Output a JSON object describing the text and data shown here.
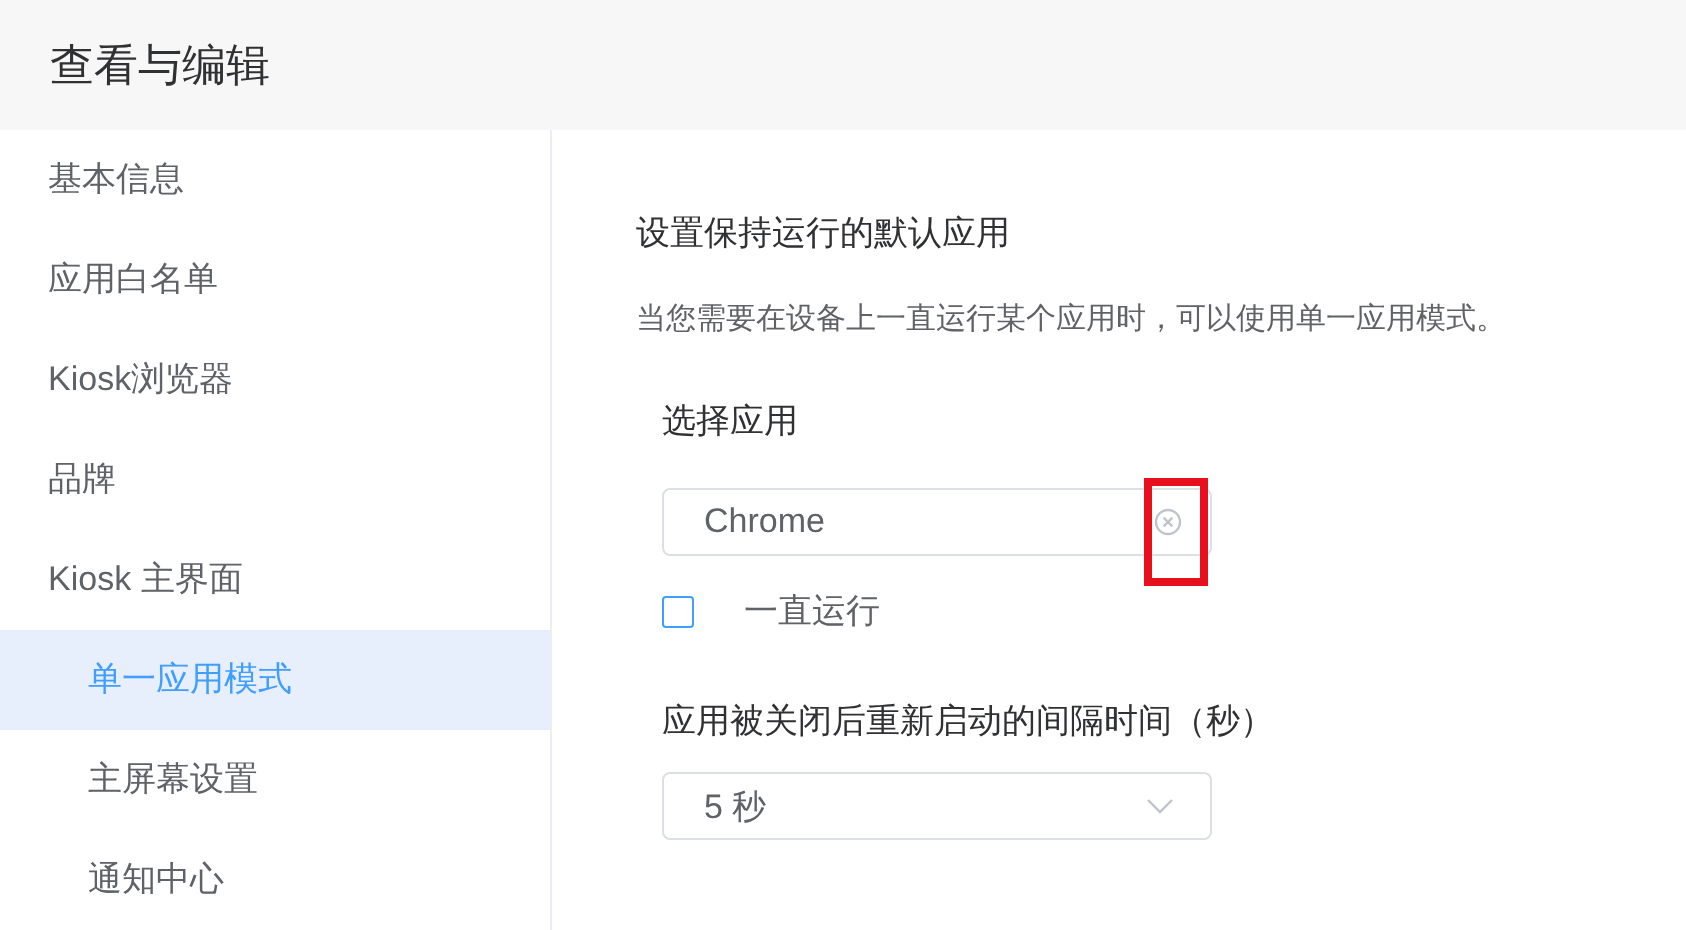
{
  "header": {
    "title": "查看与编辑"
  },
  "sidebar": {
    "items": [
      {
        "label": "基本信息",
        "selected": false
      },
      {
        "label": "应用白名单",
        "selected": false
      },
      {
        "label": "Kiosk浏览器",
        "selected": false
      },
      {
        "label": "品牌",
        "selected": false
      },
      {
        "label": "Kiosk 主界面",
        "selected": false,
        "children": [
          {
            "label": "单一应用模式",
            "selected": true
          },
          {
            "label": "主屏幕设置",
            "selected": false
          },
          {
            "label": "通知中心",
            "selected": false
          }
        ]
      }
    ]
  },
  "content": {
    "heading": "设置保持运行的默认应用",
    "description": "当您需要在设备上一直运行某个应用时，可以使用单一应用模式。",
    "app_field": {
      "label": "选择应用",
      "value": "Chrome",
      "clear_highlighted": true
    },
    "keep_running": {
      "label": "一直运行",
      "checked": false
    },
    "interval": {
      "label": "应用被关闭后重新启动的间隔时间（秒）",
      "value": "5 秒"
    }
  }
}
